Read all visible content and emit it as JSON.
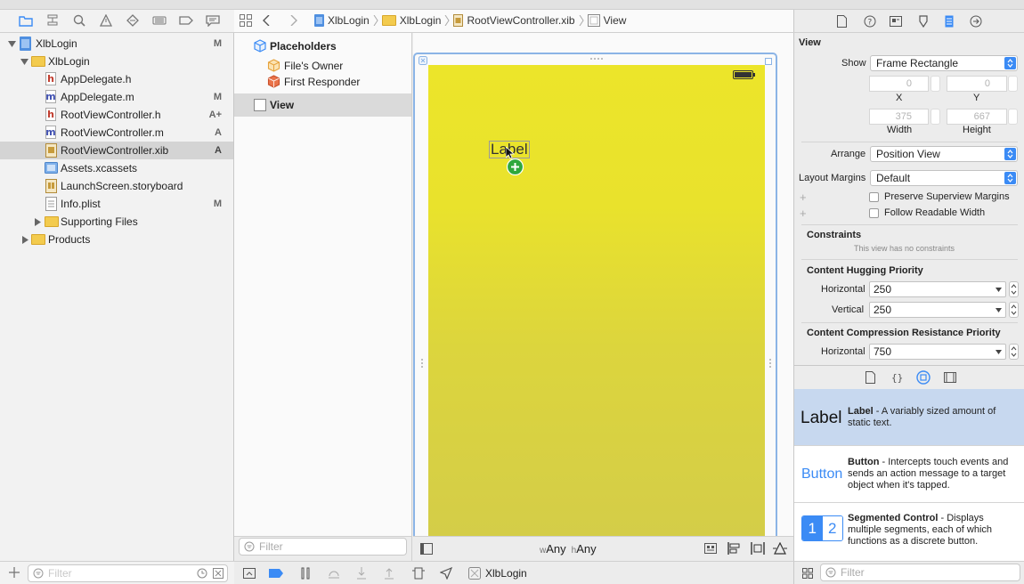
{
  "navigator": {
    "tree": [
      {
        "label": "XlbLogin",
        "status": "M",
        "kind": "project"
      },
      {
        "label": "XlbLogin",
        "status": "",
        "kind": "folder"
      },
      {
        "label": "AppDelegate.h",
        "status": "",
        "kind": "h"
      },
      {
        "label": "AppDelegate.m",
        "status": "M",
        "kind": "m"
      },
      {
        "label": "RootViewController.h",
        "status": "A+",
        "kind": "h"
      },
      {
        "label": "RootViewController.m",
        "status": "A",
        "kind": "m"
      },
      {
        "label": "RootViewController.xib",
        "status": "A",
        "kind": "xib"
      },
      {
        "label": "Assets.xcassets",
        "status": "",
        "kind": "assets"
      },
      {
        "label": "LaunchScreen.storyboard",
        "status": "",
        "kind": "storyboard"
      },
      {
        "label": "Info.plist",
        "status": "M",
        "kind": "plist"
      },
      {
        "label": "Supporting Files",
        "status": "",
        "kind": "folder"
      },
      {
        "label": "Products",
        "status": "",
        "kind": "folder"
      }
    ],
    "filter_placeholder": "Filter"
  },
  "jumpbar": {
    "crumbs": [
      "XlbLogin",
      "XlbLogin",
      "RootViewController.xib",
      "View"
    ]
  },
  "outline": {
    "placeholders_title": "Placeholders",
    "files_owner": "File's Owner",
    "first_responder": "First Responder",
    "view": "View",
    "filter_placeholder": "Filter"
  },
  "canvas": {
    "label_text": "Label",
    "size_class_w_prefix": "w",
    "size_class_w": "Any",
    "size_class_h_prefix": "h",
    "size_class_h": "Any"
  },
  "debug_bar": {
    "scheme": "XlbLogin"
  },
  "inspector": {
    "section_title": "View",
    "show_label": "Show",
    "show_value": "Frame Rectangle",
    "x_value": "0",
    "y_value": "0",
    "x_label": "X",
    "y_label": "Y",
    "width_value": "375",
    "height_value": "667",
    "width_label": "Width",
    "height_label": "Height",
    "arrange_label": "Arrange",
    "arrange_value": "Position View",
    "layout_margins_label": "Layout Margins",
    "layout_margins_value": "Default",
    "preserve_label": "Preserve Superview Margins",
    "readable_label": "Follow Readable Width",
    "constraints_title": "Constraints",
    "constraints_note": "This view has no constraints",
    "hugging_title": "Content Hugging Priority",
    "hugging_h_label": "Horizontal",
    "hugging_h_value": "250",
    "hugging_v_label": "Vertical",
    "hugging_v_value": "250",
    "compression_title": "Content Compression Resistance Priority",
    "compression_h_label": "Horizontal",
    "compression_h_value": "750"
  },
  "library": {
    "items": [
      {
        "preview": "Label",
        "name": "Label",
        "desc": " - A variably sized amount of static text."
      },
      {
        "preview": "Button",
        "name": "Button",
        "desc": " - Intercepts touch events and sends an action message to a target object when it's tapped."
      },
      {
        "preview_1": "1",
        "preview_2": "2",
        "name": "Segmented Control",
        "desc": " - Displays multiple segments, each of which functions as a discrete button."
      }
    ],
    "filter_placeholder": "Filter"
  },
  "colors": {
    "accent": "#3b8bf5",
    "scene_yellow": "#ece52a",
    "selection": "#d4d4d4",
    "library_selection": "#c7d8ef"
  }
}
